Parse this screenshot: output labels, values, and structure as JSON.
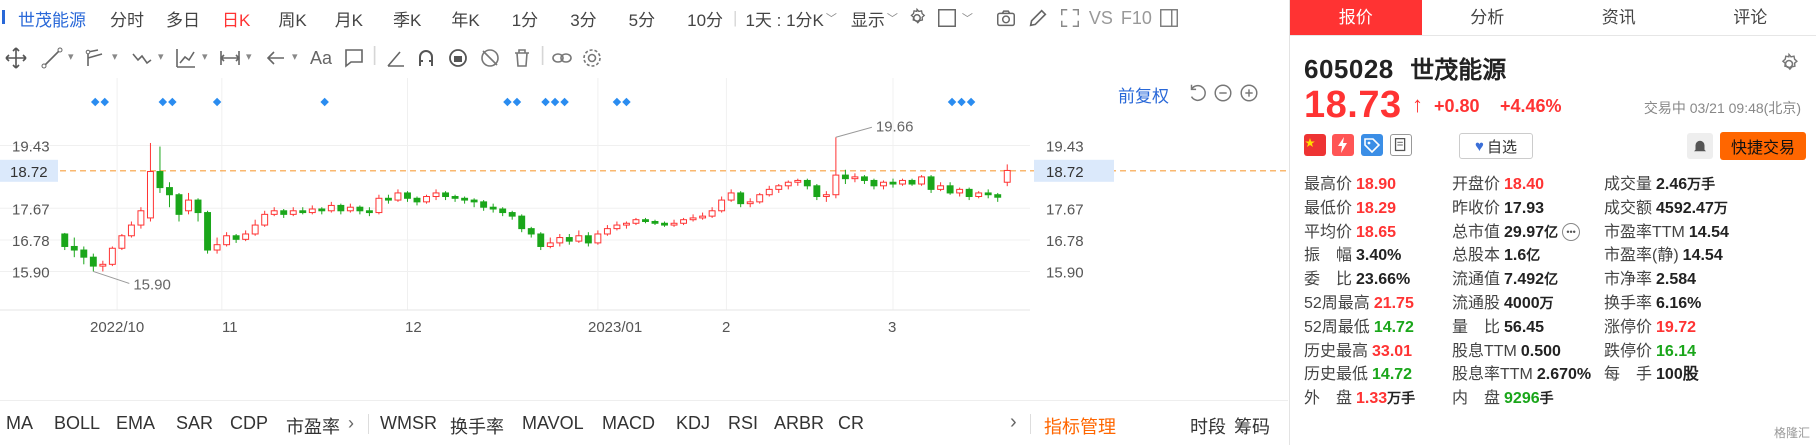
{
  "toolbar": {
    "stock_name": "世茂能源",
    "periods": [
      "分时",
      "多日",
      "日K",
      "周K",
      "月K",
      "季K",
      "年K",
      "1分",
      "3分",
      "5分",
      "10分"
    ],
    "active_period": "日K",
    "interval_select": "1天 : 1分K",
    "display_label": "显示",
    "vs_label": "VS",
    "f10_label": "F10"
  },
  "drawing_toolbar": {
    "text_tool": "Aa"
  },
  "chart_data": {
    "type": "candlestick",
    "adjust_label": "前复权",
    "y_ticks": [
      19.43,
      17.67,
      16.78,
      15.9
    ],
    "current_price_line": 18.72,
    "ylim": [
      15.1,
      20.2
    ],
    "x_tick_labels": [
      "2022/10",
      "11",
      "12",
      "2023/01",
      "2",
      "3"
    ],
    "max_label": "19.66",
    "min_label": "15.90",
    "candles": [
      [
        16.95,
        16.6,
        16.98,
        16.5
      ],
      [
        16.6,
        16.5,
        16.85,
        16.3
      ],
      [
        16.5,
        16.3,
        16.6,
        16.1
      ],
      [
        16.3,
        16.05,
        16.4,
        15.9
      ],
      [
        16.05,
        16.1,
        16.2,
        15.9
      ],
      [
        16.1,
        16.55,
        16.6,
        16.05
      ],
      [
        16.55,
        16.9,
        16.95,
        16.5
      ],
      [
        16.9,
        17.2,
        17.3,
        16.85
      ],
      [
        17.2,
        17.6,
        17.7,
        17.1
      ],
      [
        17.4,
        18.7,
        19.5,
        17.3
      ],
      [
        18.7,
        18.25,
        19.4,
        18.1
      ],
      [
        18.25,
        18.05,
        18.4,
        17.7
      ],
      [
        18.05,
        17.5,
        18.1,
        17.3
      ],
      [
        17.6,
        17.9,
        18.1,
        17.5
      ],
      [
        17.9,
        17.55,
        17.95,
        17.3
      ],
      [
        17.55,
        16.5,
        17.6,
        16.4
      ],
      [
        16.5,
        16.65,
        16.85,
        16.4
      ],
      [
        16.65,
        16.9,
        17.0,
        16.6
      ],
      [
        16.9,
        16.8,
        16.95,
        16.7
      ],
      [
        16.8,
        16.95,
        17.05,
        16.75
      ],
      [
        16.95,
        17.2,
        17.35,
        16.9
      ],
      [
        17.2,
        17.5,
        17.6,
        17.15
      ],
      [
        17.5,
        17.6,
        17.7,
        17.45
      ],
      [
        17.6,
        17.5,
        17.65,
        17.4
      ],
      [
        17.5,
        17.6,
        17.7,
        17.45
      ],
      [
        17.6,
        17.55,
        17.7,
        17.5
      ],
      [
        17.55,
        17.65,
        17.75,
        17.5
      ],
      [
        17.65,
        17.6,
        17.7,
        17.5
      ],
      [
        17.6,
        17.75,
        17.85,
        17.55
      ],
      [
        17.75,
        17.6,
        17.8,
        17.5
      ],
      [
        17.6,
        17.7,
        17.8,
        17.55
      ],
      [
        17.7,
        17.6,
        17.75,
        17.5
      ],
      [
        17.6,
        17.55,
        17.7,
        17.45
      ],
      [
        17.55,
        17.95,
        18.05,
        17.5
      ],
      [
        17.95,
        17.9,
        18.05,
        17.8
      ],
      [
        17.9,
        18.1,
        18.2,
        17.85
      ],
      [
        18.1,
        17.95,
        18.15,
        17.85
      ],
      [
        17.95,
        17.85,
        18.0,
        17.75
      ],
      [
        17.85,
        18.0,
        18.05,
        17.8
      ],
      [
        18.0,
        18.1,
        18.2,
        17.9
      ],
      [
        18.1,
        18.0,
        18.15,
        17.9
      ],
      [
        18.0,
        17.95,
        18.05,
        17.85
      ],
      [
        17.95,
        17.9,
        18.0,
        17.8
      ],
      [
        17.9,
        17.85,
        17.95,
        17.7
      ],
      [
        17.85,
        17.7,
        17.9,
        17.6
      ],
      [
        17.7,
        17.65,
        17.8,
        17.55
      ],
      [
        17.65,
        17.55,
        17.7,
        17.45
      ],
      [
        17.55,
        17.45,
        17.6,
        17.35
      ],
      [
        17.45,
        17.1,
        17.5,
        17.0
      ],
      [
        17.1,
        16.95,
        17.15,
        16.85
      ],
      [
        16.95,
        16.6,
        17.0,
        16.5
      ],
      [
        16.6,
        16.7,
        16.85,
        16.55
      ],
      [
        16.7,
        16.85,
        16.95,
        16.6
      ],
      [
        16.85,
        16.75,
        16.95,
        16.65
      ],
      [
        16.75,
        16.9,
        17.05,
        16.7
      ],
      [
        16.9,
        16.7,
        17.0,
        16.6
      ],
      [
        16.7,
        16.95,
        17.05,
        16.65
      ],
      [
        16.95,
        17.1,
        17.2,
        16.9
      ],
      [
        17.1,
        17.2,
        17.3,
        17.05
      ],
      [
        17.2,
        17.25,
        17.3,
        17.1
      ],
      [
        17.25,
        17.35,
        17.4,
        17.2
      ],
      [
        17.35,
        17.3,
        17.4,
        17.25
      ],
      [
        17.3,
        17.25,
        17.35,
        17.2
      ],
      [
        17.25,
        17.2,
        17.3,
        17.15
      ],
      [
        17.2,
        17.25,
        17.35,
        17.15
      ],
      [
        17.25,
        17.35,
        17.4,
        17.2
      ],
      [
        17.35,
        17.4,
        17.5,
        17.3
      ],
      [
        17.4,
        17.45,
        17.55,
        17.35
      ],
      [
        17.45,
        17.6,
        17.7,
        17.4
      ],
      [
        17.6,
        17.9,
        18.0,
        17.55
      ],
      [
        17.9,
        18.1,
        18.2,
        17.85
      ],
      [
        18.1,
        17.8,
        18.15,
        17.7
      ],
      [
        17.8,
        17.85,
        17.95,
        17.7
      ],
      [
        17.85,
        18.05,
        18.1,
        17.8
      ],
      [
        18.05,
        18.2,
        18.3,
        18.0
      ],
      [
        18.2,
        18.3,
        18.35,
        18.1
      ],
      [
        18.3,
        18.4,
        18.45,
        18.2
      ],
      [
        18.4,
        18.45,
        18.5,
        18.3
      ],
      [
        18.45,
        18.3,
        18.5,
        18.2
      ],
      [
        18.3,
        18.0,
        18.35,
        17.9
      ],
      [
        18.0,
        18.05,
        18.15,
        17.85
      ],
      [
        18.05,
        18.6,
        19.66,
        17.95
      ],
      [
        18.6,
        18.5,
        18.75,
        18.35
      ],
      [
        18.5,
        18.55,
        18.65,
        18.4
      ],
      [
        18.55,
        18.45,
        18.6,
        18.35
      ],
      [
        18.45,
        18.3,
        18.5,
        18.2
      ],
      [
        18.3,
        18.4,
        18.45,
        18.2
      ],
      [
        18.4,
        18.35,
        18.5,
        18.25
      ],
      [
        18.35,
        18.45,
        18.5,
        18.3
      ],
      [
        18.45,
        18.35,
        18.5,
        18.3
      ],
      [
        18.35,
        18.55,
        18.6,
        18.3
      ],
      [
        18.55,
        18.2,
        18.6,
        18.1
      ],
      [
        18.2,
        18.3,
        18.4,
        18.15
      ],
      [
        18.3,
        18.1,
        18.4,
        18.05
      ],
      [
        18.1,
        18.2,
        18.25,
        18.0
      ],
      [
        18.2,
        18.0,
        18.25,
        17.9
      ],
      [
        18.0,
        18.1,
        18.15,
        17.95
      ],
      [
        18.1,
        18.05,
        18.2,
        17.95
      ],
      [
        18.05,
        17.98,
        18.1,
        17.85
      ],
      [
        18.4,
        18.73,
        18.9,
        18.29
      ]
    ],
    "marker_positions": [
      0.037,
      0.047,
      0.108,
      0.118,
      0.165,
      0.278,
      0.47,
      0.48,
      0.51,
      0.52,
      0.53,
      0.585,
      0.595,
      0.937,
      0.947,
      0.957
    ]
  },
  "indicators": {
    "items": [
      "MA",
      "BOLL",
      "EMA",
      "SAR",
      "CDP",
      "市盈率",
      "WMSR",
      "换手率",
      "MAVOL",
      "MACD",
      "KDJ",
      "RSI",
      "ARBR",
      "CR"
    ],
    "manager": "指标管理",
    "right": [
      "时段",
      "筹码"
    ]
  },
  "right_tabs": [
    "报价",
    "分析",
    "资讯",
    "评论"
  ],
  "quote": {
    "code": "605028",
    "name": "世茂能源",
    "price": "18.73",
    "change": "+0.80",
    "percent": "+4.46%",
    "time": "交易中 03/21 09:48(北京)",
    "watch_label": "自选",
    "fast_trade": "快捷交易"
  },
  "stats": [
    [
      {
        "label": "最高价",
        "value": "18.90",
        "color": "red"
      },
      {
        "label": "开盘价",
        "value": "18.40",
        "color": "red"
      },
      {
        "label": "成交量",
        "value": "2.46",
        "unit": "万手",
        "color": "black"
      }
    ],
    [
      {
        "label": "最低价",
        "value": "18.29",
        "color": "red"
      },
      {
        "label": "昨收价",
        "value": "17.93",
        "color": "black"
      },
      {
        "label": "成交额",
        "value": "4592.47",
        "unit": "万",
        "color": "black"
      }
    ],
    [
      {
        "label": "平均价",
        "value": "18.65",
        "color": "red"
      },
      {
        "label": "总市值",
        "value": "29.97",
        "unit": "亿",
        "color": "black",
        "more": true
      },
      {
        "label": "市盈率TTM",
        "value": "14.54",
        "color": "black"
      }
    ],
    [
      {
        "label": "振　幅",
        "value": "3.40%",
        "color": "black"
      },
      {
        "label": "总股本",
        "value": "1.6",
        "unit": "亿",
        "color": "black"
      },
      {
        "label": "市盈率(静)",
        "value": "14.54",
        "color": "black"
      }
    ],
    [
      {
        "label": "委　比",
        "value": "23.66%",
        "color": "black"
      },
      {
        "label": "流通值",
        "value": "7.492",
        "unit": "亿",
        "color": "black"
      },
      {
        "label": "市净率",
        "value": "2.584",
        "color": "black"
      }
    ],
    [
      {
        "label": "52周最高",
        "value": "21.75",
        "color": "red"
      },
      {
        "label": "流通股",
        "value": "4000",
        "unit": "万",
        "color": "black"
      },
      {
        "label": "换手率",
        "value": "6.16%",
        "color": "black"
      }
    ],
    [
      {
        "label": "52周最低",
        "value": "14.72",
        "color": "green"
      },
      {
        "label": "量　比",
        "value": "56.45",
        "color": "black"
      },
      {
        "label": "涨停价",
        "value": "19.72",
        "color": "red"
      }
    ],
    [
      {
        "label": "历史最高",
        "value": "33.01",
        "color": "red"
      },
      {
        "label": "股息TTM",
        "value": "0.500",
        "color": "black"
      },
      {
        "label": "跌停价",
        "value": "16.14",
        "color": "green"
      }
    ],
    [
      {
        "label": "历史最低",
        "value": "14.72",
        "color": "green"
      },
      {
        "label": "股息率TTM",
        "value": "2.670%",
        "color": "black"
      },
      {
        "label": "每　手",
        "value": "100股",
        "color": "black"
      }
    ],
    [
      {
        "label": "外　盘",
        "value": "1.33",
        "unit": "万手",
        "color": "red"
      },
      {
        "label": "内　盘",
        "value": "9296",
        "unit": "手",
        "color": "green"
      },
      {
        "label": "",
        "value": "",
        "color": "black"
      }
    ]
  ],
  "watermark": "格隆汇",
  "colors": {
    "up": "#ff3333",
    "down": "#1aa61a",
    "accent": "#2968d8",
    "orange": "#ff6600",
    "marker": "#2a8cf0"
  }
}
